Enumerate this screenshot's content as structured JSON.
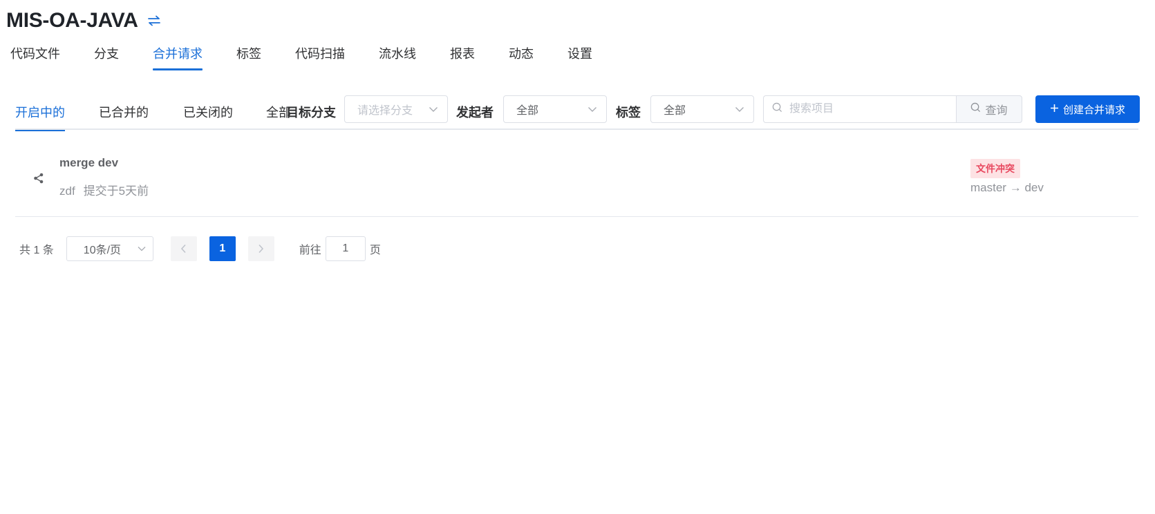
{
  "repo": {
    "title": "MIS-OA-JAVA",
    "switch_icon": "switch-arrows-icon"
  },
  "nav": {
    "items": [
      {
        "label": "代码文件"
      },
      {
        "label": "分支"
      },
      {
        "label": "合并请求",
        "active": true
      },
      {
        "label": "标签"
      },
      {
        "label": "代码扫描"
      },
      {
        "label": "流水线"
      },
      {
        "label": "报表"
      },
      {
        "label": "动态"
      },
      {
        "label": "设置"
      }
    ]
  },
  "status_tabs": [
    {
      "label": "开启中的",
      "active": true
    },
    {
      "label": "已合并的"
    },
    {
      "label": "已关闭的"
    },
    {
      "label": "全部"
    }
  ],
  "filters": {
    "target_branch_label": "目标分支",
    "target_branch_placeholder": "请选择分支",
    "author_label": "发起者",
    "author_value": "全部",
    "tag_label": "标签",
    "tag_value": "全部",
    "search_placeholder": "搜索项目",
    "search_button": "查询",
    "create_button": "创建合并请求"
  },
  "merge_requests": [
    {
      "title": "merge dev",
      "author": "zdf",
      "time": "提交于5天前",
      "badge": "文件冲突",
      "source_branch": "master",
      "arrow": "→",
      "target_branch": "dev"
    }
  ],
  "pagination": {
    "total": "共 1 条",
    "page_size": "10条/页",
    "current_page": "1",
    "goto_label": "前往",
    "goto_value": "1",
    "goto_suffix": "页"
  },
  "colors": {
    "primary": "#0a63e0",
    "active_text": "#1a6fd8",
    "badge_bg": "#fde2e4",
    "badge_text": "#e8485f"
  }
}
